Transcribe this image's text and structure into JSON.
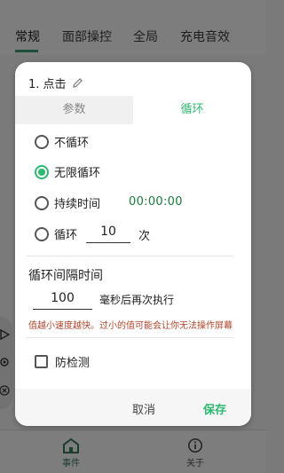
{
  "app": {
    "top_tabs": [
      "常规",
      "面部操控",
      "全局",
      "充电音效"
    ],
    "bottom_nav": [
      {
        "label": "事件",
        "icon": "home-icon"
      },
      {
        "label": "关于",
        "icon": "info-icon"
      }
    ],
    "side_icons": [
      "play-icon",
      "gear-icon",
      "close-icon"
    ]
  },
  "dialog": {
    "title": "1. 点击",
    "title_icon": "pencil-icon",
    "tabs": {
      "param": "参数",
      "loop": "循环"
    },
    "options": {
      "no_loop": "不循环",
      "infinite": "无限循环",
      "duration": "持续时间",
      "duration_value": "00:00:00",
      "count": "循环",
      "count_value": "10",
      "count_unit": "次",
      "selected": "infinite"
    },
    "interval": {
      "title": "循环间隔时间",
      "value": "100",
      "unit": "毫秒后再次执行",
      "warning": "值越小速度越快。过小的值可能会让你无法操作屏幕"
    },
    "anti_detect": {
      "label": "防检测",
      "checked": false
    },
    "buttons": {
      "cancel": "取消",
      "save": "保存"
    }
  },
  "colors": {
    "accent": "#2fb870",
    "warning": "#b0462c",
    "time": "#1b7a3a",
    "overlay": "#7a7a7a"
  }
}
